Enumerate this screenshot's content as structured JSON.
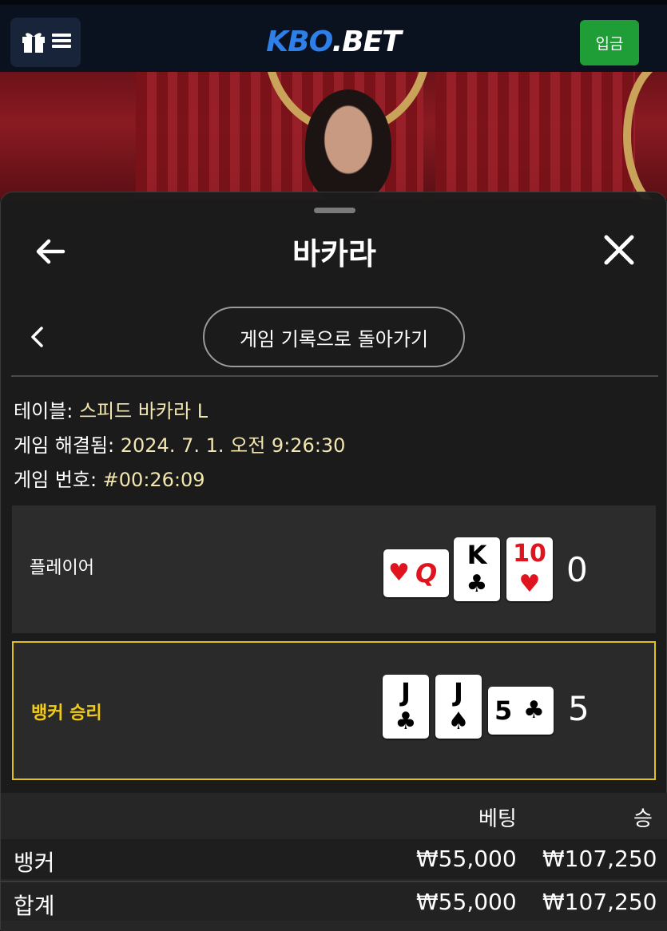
{
  "header": {
    "logo_main": "KBO",
    "logo_suffix": ".BET",
    "deposit_label": "입금"
  },
  "panel": {
    "title": "바카라",
    "back_to_history": "게임 기록으로 돌아가기"
  },
  "info": {
    "table_label": "테이블: ",
    "table_value": "스피드 바카라 L",
    "resolved_label": "게임 해결됨: ",
    "resolved_value": "2024. 7. 1. 오전 9:26:30",
    "number_label": "게임 번호: ",
    "number_value": "#00:26:09"
  },
  "hands": {
    "player": {
      "label": "플레이어",
      "score": "0",
      "cards": [
        {
          "rank": "Q",
          "suit": "♥",
          "orientation": "sideways"
        },
        {
          "rank": "K",
          "suit": "♣"
        },
        {
          "rank": "10",
          "suit": "♥"
        }
      ]
    },
    "banker": {
      "label": "뱅커 승리",
      "score": "5",
      "cards": [
        {
          "rank": "J",
          "suit": "♣"
        },
        {
          "rank": "J",
          "suit": "♠"
        },
        {
          "rank": "5",
          "suit": "♣",
          "orientation": "sideways"
        }
      ]
    }
  },
  "totals": {
    "col_bet": "베팅",
    "col_win": "승",
    "rows": [
      {
        "name": "뱅커",
        "bet": "₩55,000",
        "win": "₩107,250"
      },
      {
        "name": "합계",
        "bet": "₩55,000",
        "win": "₩107,250"
      }
    ]
  },
  "colors": {
    "header_bg": "#0a1220",
    "logo_blue": "#2f7fe8",
    "deposit_green": "#1f9d37",
    "win_border": "#e0c21d",
    "info_value": "#f2e6b0"
  },
  "icons": [
    "gift-icon",
    "menu-icon",
    "back-arrow-icon",
    "close-icon",
    "chevron-left-icon"
  ]
}
